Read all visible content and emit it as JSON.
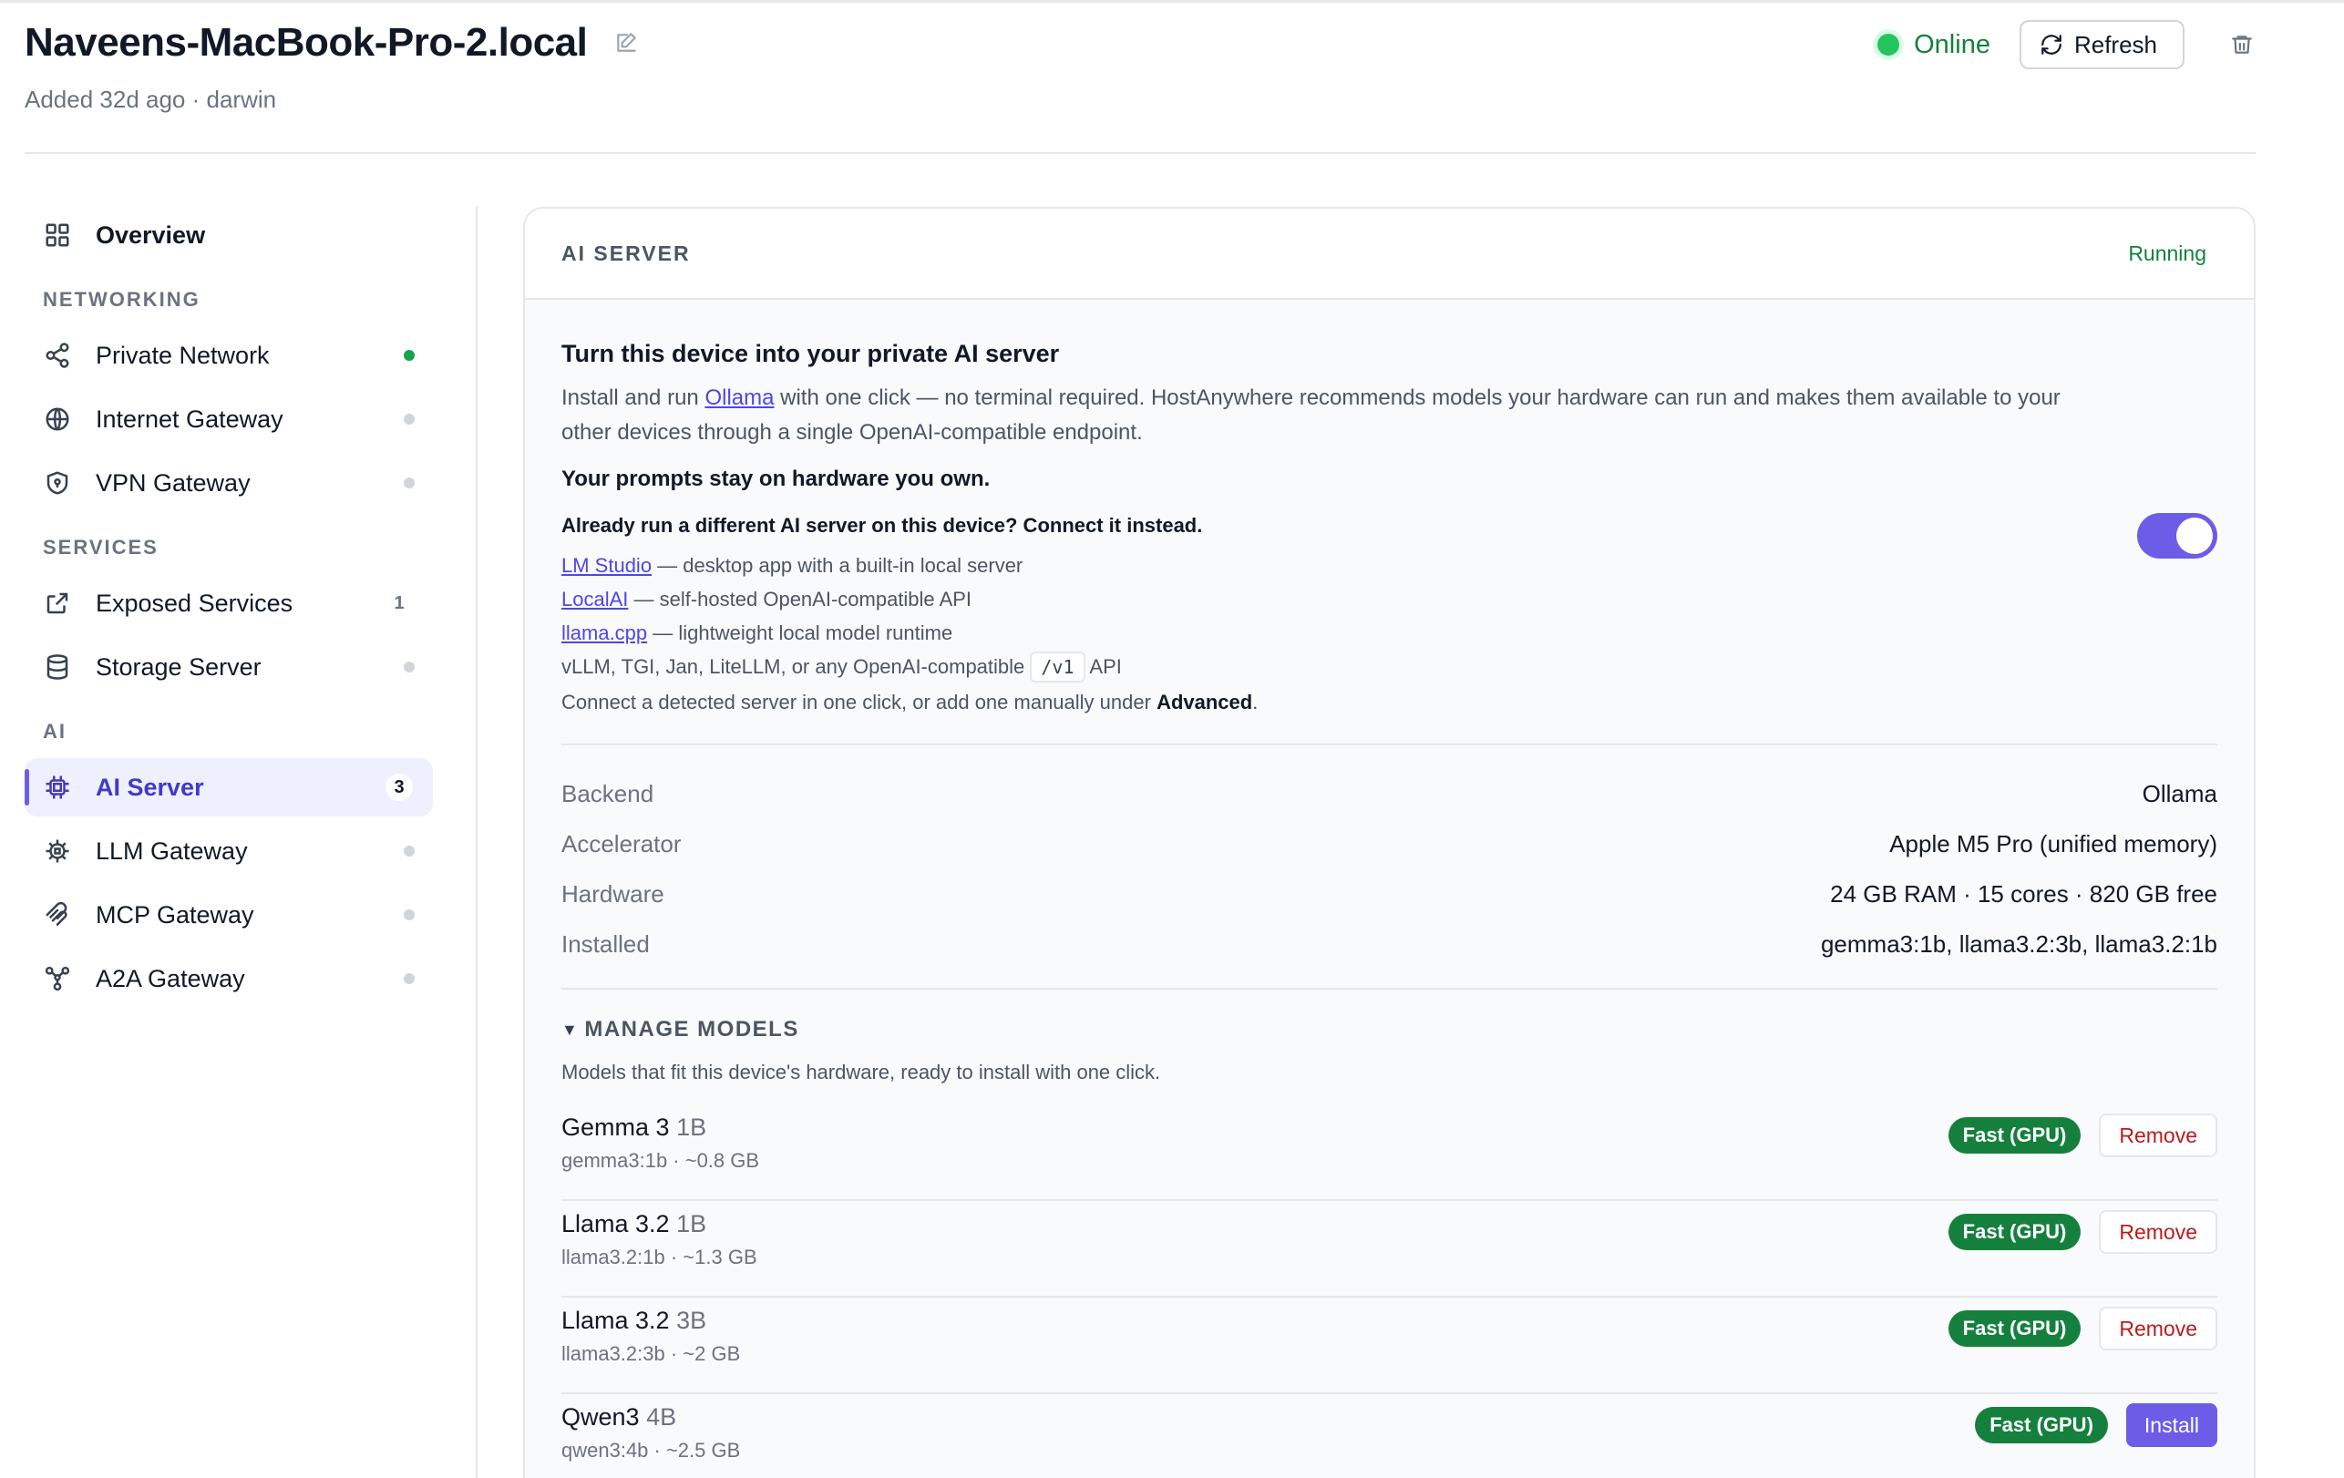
{
  "header": {
    "title": "Naveens-MacBook-Pro-2.local",
    "subtitle": "Added 32d ago · darwin",
    "status": "Online",
    "refresh_label": "Refresh"
  },
  "sidebar": {
    "overview": "Overview",
    "sections": {
      "networking": "NETWORKING",
      "services": "SERVICES",
      "ai": "AI"
    },
    "items": {
      "private_network": "Private Network",
      "internet_gateway": "Internet Gateway",
      "vpn_gateway": "VPN Gateway",
      "exposed_services": "Exposed Services",
      "exposed_services_count": "1",
      "storage_server": "Storage Server",
      "ai_server": "AI Server",
      "ai_server_count": "3",
      "llm_gateway": "LLM Gateway",
      "mcp_gateway": "MCP Gateway",
      "a2a_gateway": "A2A Gateway"
    }
  },
  "card": {
    "title": "AI SERVER",
    "status": "Running",
    "intro_title": "Turn this device into your private AI server",
    "intro_pre": "Install and run ",
    "intro_link": "Ollama",
    "intro_post": " with one click — no terminal required. HostAnywhere recommends models your hardware can run and makes them available to your other devices through a single OpenAI-compatible endpoint.",
    "intro_strong": "Your prompts stay on hardware you own.",
    "alt_title": "Already run a different AI server on this device? Connect it instead.",
    "alternatives": [
      {
        "link": "LM Studio",
        "desc": " — desktop app with a built-in local server"
      },
      {
        "link": "LocalAI",
        "desc": " — self-hosted OpenAI-compatible API"
      },
      {
        "link": "llama.cpp",
        "desc": " — lightweight local model runtime"
      }
    ],
    "alt_other_pre": "vLLM, TGI, Jan, LiteLLM, or any OpenAI-compatible ",
    "alt_other_code": "/v1",
    "alt_other_post": " API",
    "connect_note_pre": "Connect a detected server in one click, or add one manually under ",
    "connect_note_bold": "Advanced",
    "connect_note_post": ".",
    "specs": [
      {
        "key": "Backend",
        "value": "Ollama"
      },
      {
        "key": "Accelerator",
        "value": "Apple M5 Pro (unified memory)"
      },
      {
        "key": "Hardware",
        "value": "24 GB RAM · 15 cores · 820 GB free"
      },
      {
        "key": "Installed",
        "value": "gemma3:1b, llama3.2:3b, llama3.2:1b"
      }
    ],
    "manage_title": "MANAGE MODELS",
    "manage_desc": "Models that fit this device's hardware, ready to install with one click.",
    "models": [
      {
        "name": "Gemma 3",
        "size": "1B",
        "meta": "gemma3:1b · ~0.8 GB",
        "badge": "Fast (GPU)",
        "action": "Remove"
      },
      {
        "name": "Llama 3.2",
        "size": "1B",
        "meta": "llama3.2:1b · ~1.3 GB",
        "badge": "Fast (GPU)",
        "action": "Remove"
      },
      {
        "name": "Llama 3.2",
        "size": "3B",
        "meta": "llama3.2:3b · ~2 GB",
        "badge": "Fast (GPU)",
        "action": "Remove"
      },
      {
        "name": "Qwen3",
        "size": "4B",
        "meta": "qwen3:4b · ~2.5 GB",
        "badge": "Fast (GPU)",
        "action": "Install"
      }
    ]
  }
}
